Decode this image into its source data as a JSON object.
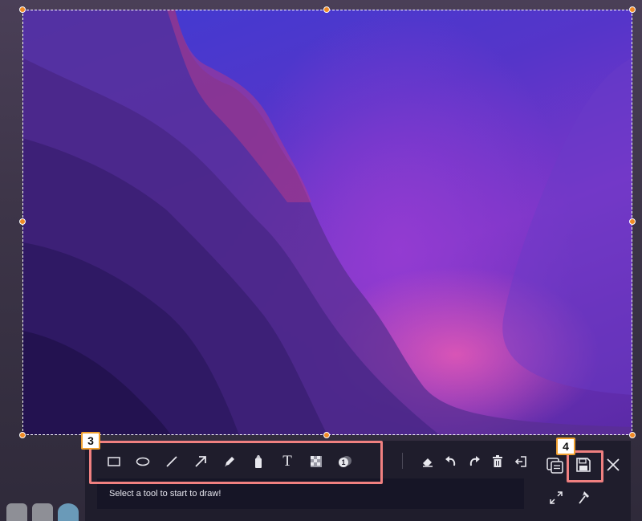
{
  "toolbar": {
    "tools": [
      {
        "name": "rectangle-tool",
        "icon": "rectangle-icon"
      },
      {
        "name": "ellipse-tool",
        "icon": "ellipse-icon"
      },
      {
        "name": "line-tool",
        "icon": "line-icon"
      },
      {
        "name": "arrow-tool",
        "icon": "arrow-icon"
      },
      {
        "name": "pencil-tool",
        "icon": "pencil-icon"
      },
      {
        "name": "marker-tool",
        "icon": "marker-icon"
      },
      {
        "name": "text-tool",
        "icon": "text-icon",
        "glyph": "T"
      },
      {
        "name": "mosaic-tool",
        "icon": "mosaic-icon"
      },
      {
        "name": "step-number-tool",
        "icon": "number-badge-icon",
        "glyph": "1"
      }
    ],
    "edit_actions": [
      {
        "name": "eraser-button",
        "icon": "eraser-icon"
      },
      {
        "name": "undo-button",
        "icon": "undo-icon"
      },
      {
        "name": "redo-button",
        "icon": "redo-icon"
      },
      {
        "name": "delete-button",
        "icon": "trash-icon"
      },
      {
        "name": "exit-button",
        "icon": "exit-icon"
      }
    ],
    "status_text": "Select a tool to start to draw!",
    "actions": [
      {
        "name": "copy-button",
        "icon": "copy-icon"
      },
      {
        "name": "save-button",
        "icon": "save-icon"
      },
      {
        "name": "close-button",
        "icon": "close-icon"
      },
      {
        "name": "fullscreen-button",
        "icon": "expand-icon"
      },
      {
        "name": "pin-button",
        "icon": "pin-icon"
      }
    ]
  },
  "callouts": {
    "tools_badge": "3",
    "save_badge": "4"
  },
  "colors": {
    "handle": "#f08a24",
    "callout_border": "#f08080",
    "badge_border": "#f0a030",
    "toolbar_bg": "#1f1d2c"
  }
}
